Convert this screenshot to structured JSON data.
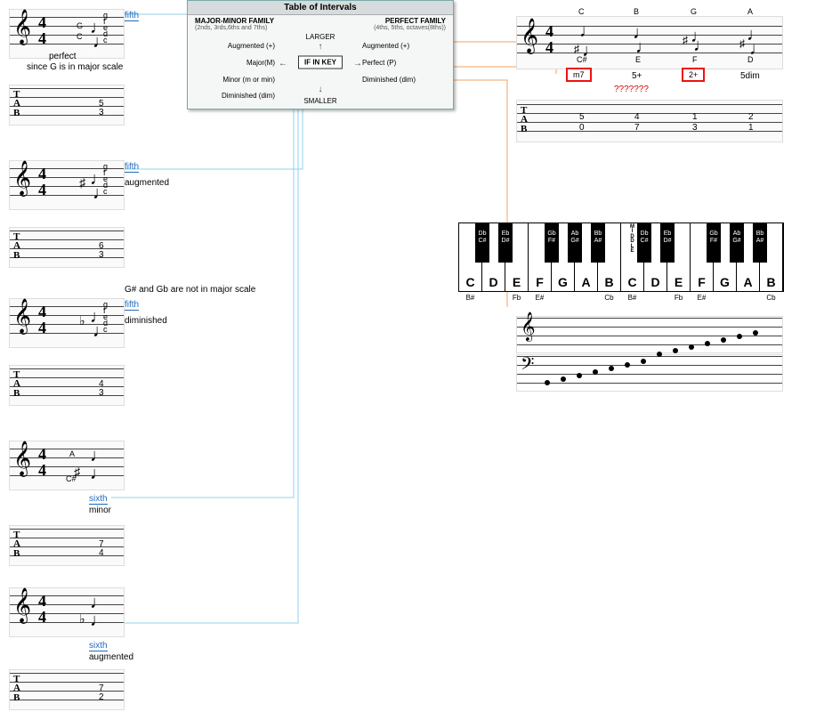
{
  "intervals_table": {
    "title": "Table of Intervals",
    "left_heading": "MAJOR-MINOR FAMILY",
    "left_sub": "(2nds, 3rds,6ths and 7ths)",
    "right_heading": "PERFECT FAMILY",
    "right_sub": "(4ths, 5ths, octaves(8ths))",
    "center": "IF IN KEY",
    "larger": "LARGER",
    "smaller": "SMALLER",
    "left_aug": "Augmented (+)",
    "left_maj": "Major(M)",
    "left_min": "Minor (m or min)",
    "left_dim": "Diminished (dim)",
    "right_aug": "Augmented (+)",
    "right_perf": "Perfect (P)",
    "right_dim": "Diminished (dim)"
  },
  "examples": [
    {
      "interval": "fifth",
      "quality": "perfect",
      "explain": "since G is in major scale",
      "root": "C",
      "top": "G",
      "stack": [
        "g",
        "f",
        "e",
        "d",
        "c"
      ],
      "tab": [
        "5",
        "3"
      ]
    },
    {
      "interval": "fifth",
      "quality": "augmented",
      "stack": [
        "g",
        "f",
        "e",
        "d",
        "c"
      ],
      "tab": [
        "6",
        "3"
      ]
    },
    {
      "interval": "fifth",
      "quality": "diminished",
      "note_between": "G# and Gb are not in major scale",
      "stack": [
        "g",
        "f",
        "e",
        "d",
        "c"
      ],
      "tab": [
        "4",
        "3"
      ]
    },
    {
      "interval": "sixth",
      "quality": "minor",
      "root": "C#",
      "top": "A",
      "tab": [
        "7",
        "4"
      ]
    },
    {
      "interval": "sixth",
      "quality": "augmented",
      "tab": [
        "7",
        "2"
      ]
    }
  ],
  "right_exercise": {
    "chords": [
      {
        "top": "C",
        "bottom": "C#",
        "ans": "m7",
        "tab": [
          "5",
          "0"
        ]
      },
      {
        "top": "B",
        "bottom": "E",
        "ans": "5+",
        "tab": [
          "4",
          "7"
        ]
      },
      {
        "top": "G",
        "bottom": "F",
        "ans": "2+",
        "tab": [
          "1",
          "3"
        ]
      },
      {
        "top": "A",
        "bottom": "D",
        "ans": "5dim",
        "tab": [
          "2",
          "1"
        ]
      }
    ],
    "warn": "???????"
  },
  "piano": {
    "white": [
      "C",
      "D",
      "E",
      "F",
      "G",
      "A",
      "B",
      "C",
      "D",
      "E",
      "F",
      "G",
      "A",
      "B"
    ],
    "white_sub": [
      "B#",
      "",
      "Fb",
      "E#",
      "",
      "",
      "Cb",
      "B#",
      "",
      "Fb",
      "E#",
      "",
      "",
      "Cb"
    ],
    "black": [
      {
        "pos": 0,
        "lab": "Db\nC#"
      },
      {
        "pos": 1,
        "lab": "Eb\nD#"
      },
      {
        "pos": 3,
        "lab": "Gb\nF#"
      },
      {
        "pos": 4,
        "lab": "Ab\nG#"
      },
      {
        "pos": 5,
        "lab": "Bb\nA#"
      },
      {
        "pos": 7,
        "lab": "Db\nC#"
      },
      {
        "pos": 8,
        "lab": "Eb\nD#"
      },
      {
        "pos": 10,
        "lab": "Gb\nF#"
      },
      {
        "pos": 11,
        "lab": "Ab\nG#"
      },
      {
        "pos": 12,
        "lab": "Bb\nA#"
      }
    ],
    "middle_c_index": 7,
    "middle_c_text": "MIDDLE"
  }
}
